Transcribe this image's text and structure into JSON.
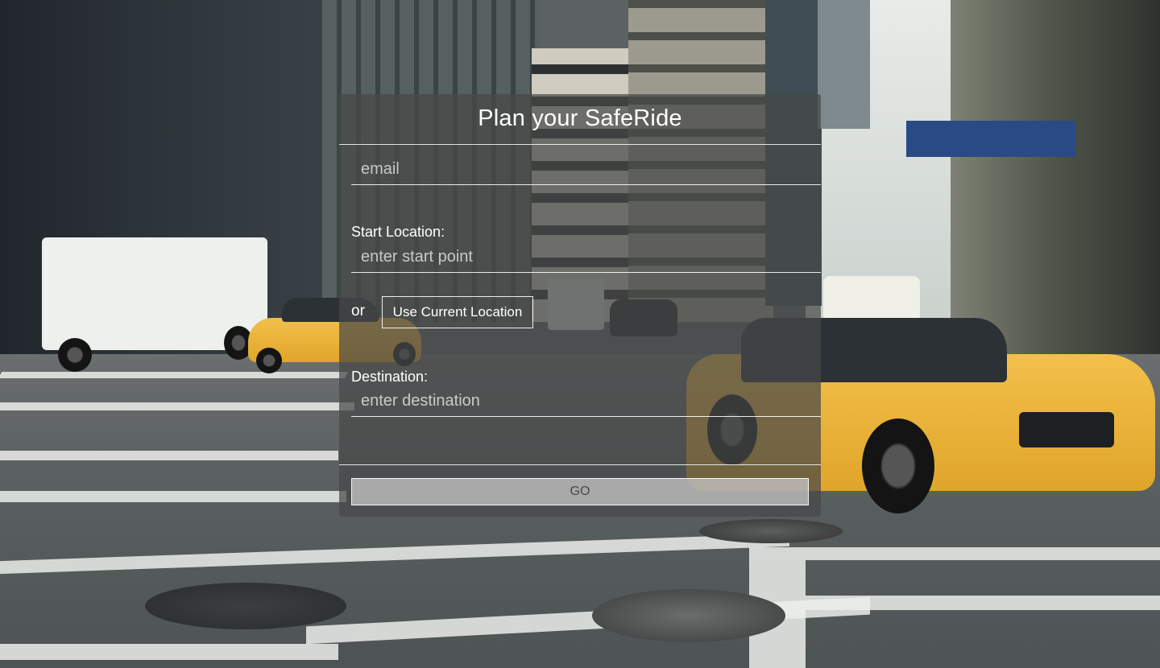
{
  "form": {
    "title": "Plan your SafeRide",
    "email_placeholder": "email",
    "start_label": "Start Location:",
    "start_placeholder": "enter start point",
    "or_text": "or",
    "current_location_label": "Use Current Location",
    "destination_label": "Destination:",
    "destination_placeholder": "enter destination",
    "go_label": "GO"
  },
  "colors": {
    "panel_overlay": "#464848",
    "text": "#ffffff",
    "go_button_bg": "#cdcdcd",
    "go_button_text": "#4a4a4a",
    "taxi_yellow": "#f0b43a"
  }
}
